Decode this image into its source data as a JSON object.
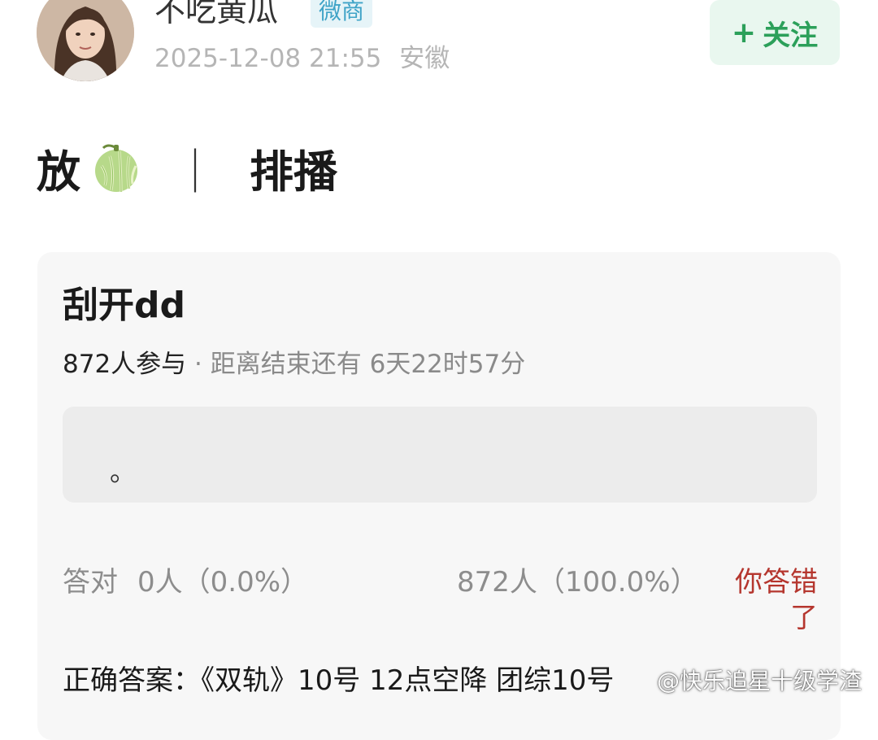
{
  "post": {
    "author": {
      "name": "不吃黄瓜",
      "badge": "微商",
      "timestamp": "2025-12-08 21:55",
      "location": "安徽",
      "avatar": "avatar-photo"
    },
    "follow_label": "关注",
    "follow_icon": "plus-icon",
    "content": {
      "text_before": "放",
      "emoji": "melon-emoji",
      "separator": "｜",
      "text_after": "排播"
    }
  },
  "quiz": {
    "title": "刮开dd",
    "participants": "872人参与",
    "dot": " · ",
    "countdown_label": "距离结束还有",
    "countdown": "6天22时57分",
    "answer_placeholder": "。",
    "correct_label": "答对",
    "correct_count": "0人（0.0%）",
    "wrong_count": "872人（100.0%）",
    "wrong_label": "你答错了",
    "correct_answer": "正确答案：《双轨》10号 12点空降 团综10号"
  },
  "watermark": "@快乐追星十级学渣",
  "colors": {
    "follow_green": "#2ca05a",
    "follow_bg": "#e9f7ef",
    "badge_blue": "#3fa3c7",
    "wrong_red": "#b5362e",
    "card_bg": "#f7f7f7"
  }
}
